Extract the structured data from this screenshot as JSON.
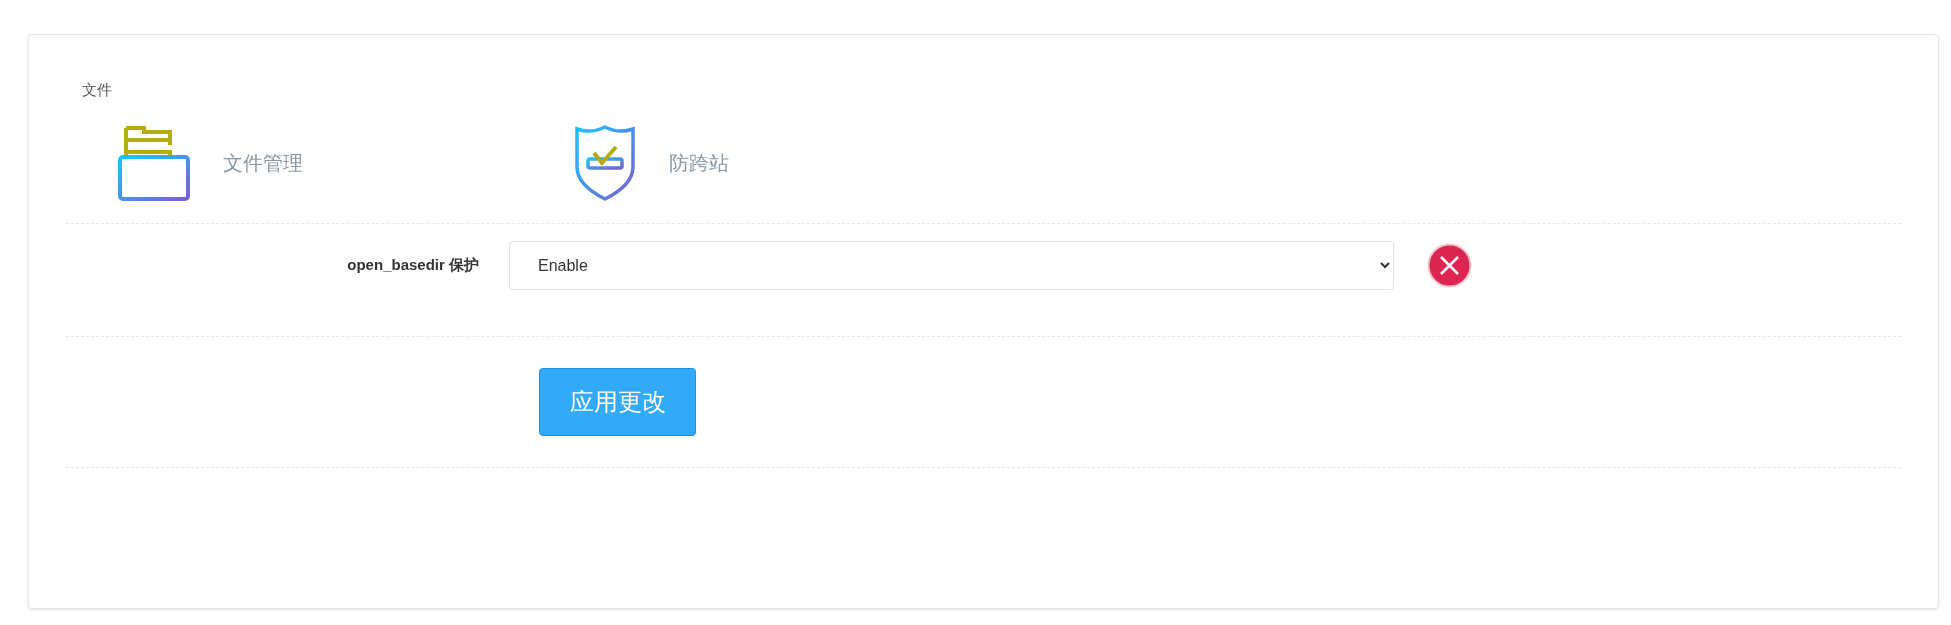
{
  "section_title": "文件",
  "shortcuts": [
    {
      "kind": "files",
      "label": "文件管理"
    },
    {
      "kind": "shield",
      "label": "防跨站"
    }
  ],
  "setting": {
    "label": "open_basedir 保护",
    "value": "Enable"
  },
  "apply_button": "应用更改"
}
